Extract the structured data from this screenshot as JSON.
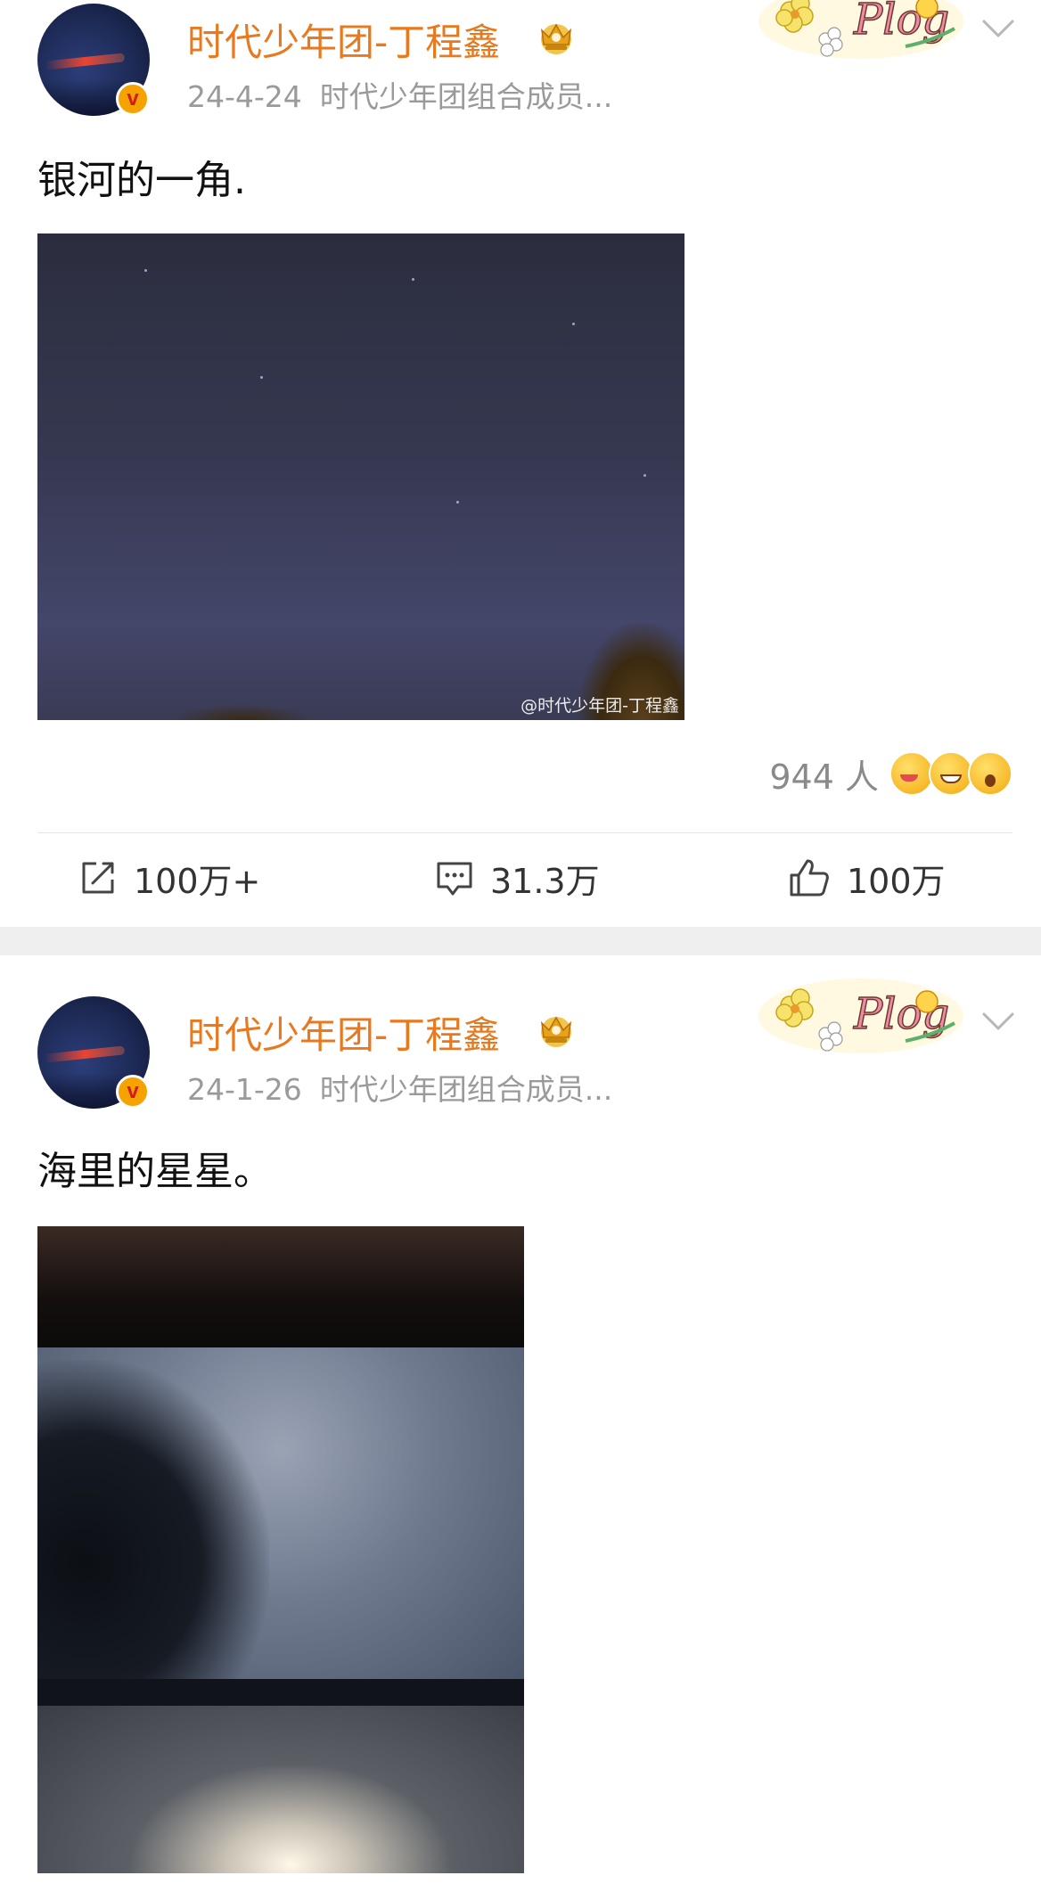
{
  "colors": {
    "username": "#e8791e",
    "meta": "#9a9a9a",
    "verified_badge": "#f6a200"
  },
  "posts": [
    {
      "username": "时代少年团-丁程鑫",
      "date": "24-4-24",
      "source": "时代少年团组合成员...",
      "text": "银河的一角.",
      "watermark": "@时代少年团-丁程鑫",
      "reaction_count": "944 人",
      "share_count": "100万+",
      "comment_count": "31.3万",
      "like_count": "100万",
      "badge_letter": "v",
      "icons": [
        "crown-icon",
        "plog-sticker",
        "chevron-down-icon",
        "share-icon",
        "comment-icon",
        "like-icon"
      ]
    },
    {
      "username": "时代少年团-丁程鑫",
      "date": "24-1-26",
      "source": "时代少年团组合成员...",
      "text": "海里的星星。",
      "badge_letter": "v",
      "icons": [
        "crown-icon",
        "plog-sticker",
        "chevron-down-icon"
      ]
    }
  ],
  "sticker_text": "Plog"
}
